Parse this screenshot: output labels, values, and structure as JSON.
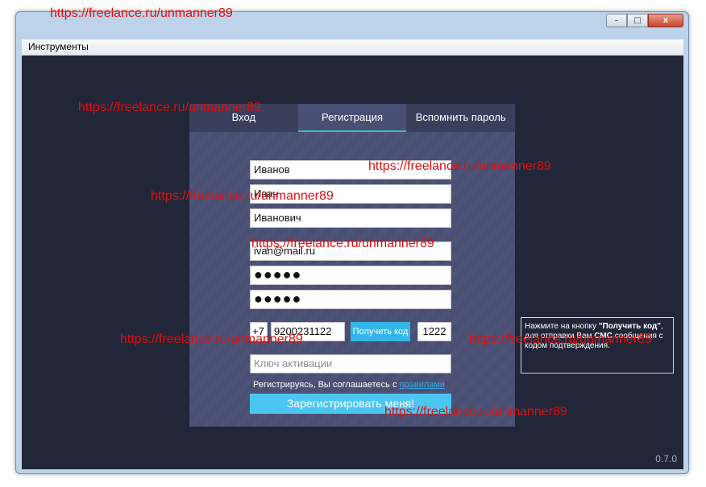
{
  "window": {
    "controls": {
      "minimize": "–",
      "maximize": "□",
      "close": "x"
    }
  },
  "menu": {
    "tools": "Инструменты"
  },
  "tabs": [
    "Вход",
    "Регистрация",
    "Вспомнить пароль"
  ],
  "form": {
    "last_name": "Иванов",
    "first_name": "Иван",
    "middle_name": "Иванович",
    "email": "ivan@mail.ru",
    "password": "●●●●●",
    "password_confirm": "●●●●●",
    "phone_prefix": "+7",
    "phone": "9200231122",
    "get_code_label": "Получить код",
    "sms_code": "1222",
    "activation_placeholder": "Ключ активации",
    "agree_text": "Регистрируясь, Вы соглашаетесь с ",
    "agree_link": "правилами",
    "register_label": "Зарегистрировать меня!"
  },
  "tooltip": {
    "part1": "Нажмите на кнопку ",
    "bold1": "\"Получить код\"",
    "part2": ", для отправки Вам ",
    "bold2": "СМС",
    "part3": " сообщения с кодом подтверждения."
  },
  "version": "0.7.0",
  "watermark": "https://freelance.ru/unmanner89"
}
